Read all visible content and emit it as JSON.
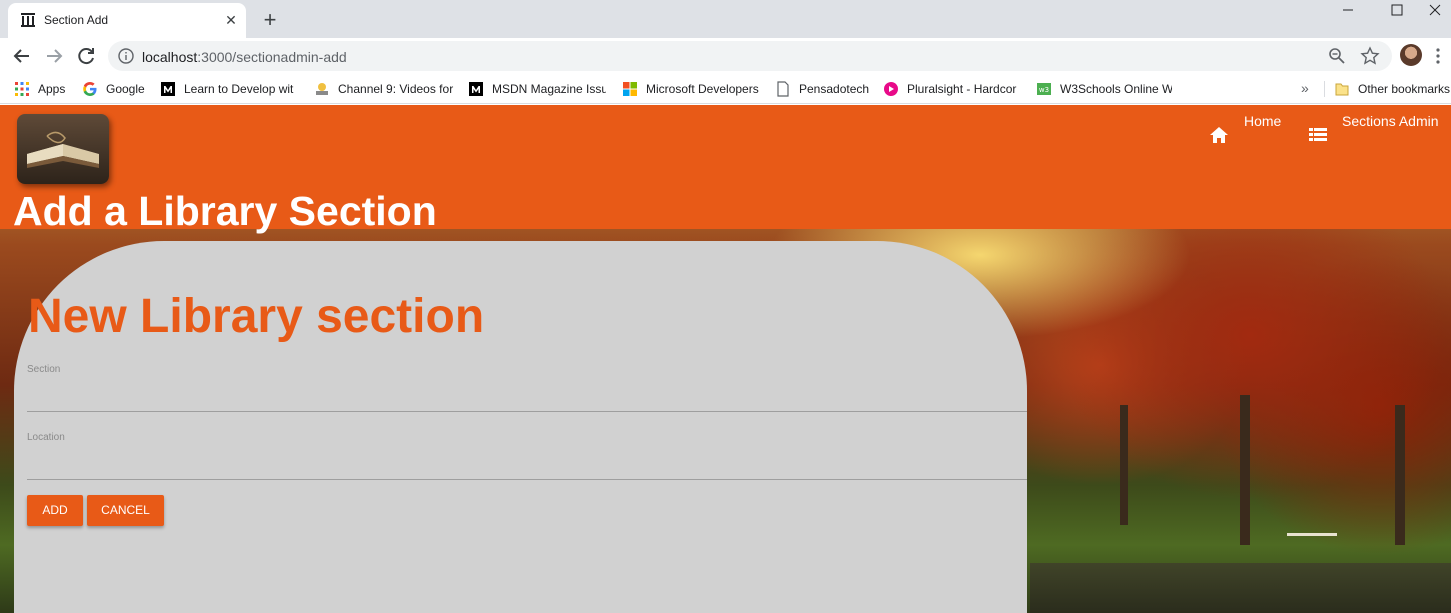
{
  "browser": {
    "tab": {
      "title": "Section Add"
    },
    "url": {
      "host": "localhost",
      "rest": ":3000/sectionadmin-add"
    },
    "bookmarks": [
      {
        "label": "Apps",
        "icon": "apps-grid-icon"
      },
      {
        "label": "Google",
        "icon": "google-icon"
      },
      {
        "label": "Learn to Develop wit",
        "icon": "medium-icon"
      },
      {
        "label": "Channel 9: Videos for",
        "icon": "channel9-icon"
      },
      {
        "label": "MSDN Magazine Issu",
        "icon": "medium-icon"
      },
      {
        "label": "Microsoft Developers",
        "icon": "microsoft-icon"
      },
      {
        "label": "Pensadotech",
        "icon": "page-icon"
      },
      {
        "label": "Pluralsight - Hardcor",
        "icon": "pluralsight-icon"
      },
      {
        "label": "W3Schools Online W",
        "icon": "w3schools-icon"
      }
    ],
    "other_bookmarks": "Other bookmarks"
  },
  "app": {
    "heading": "Add a Library Section",
    "nav": {
      "home": "Home",
      "sections_admin": "Sections Admin"
    }
  },
  "form": {
    "title": "New Library section",
    "section_label": "Section",
    "location_label": "Location",
    "add_label": "ADD",
    "cancel_label": "CANCEL"
  },
  "colors": {
    "accent": "#e85a17",
    "card": "#d1d1d1"
  }
}
